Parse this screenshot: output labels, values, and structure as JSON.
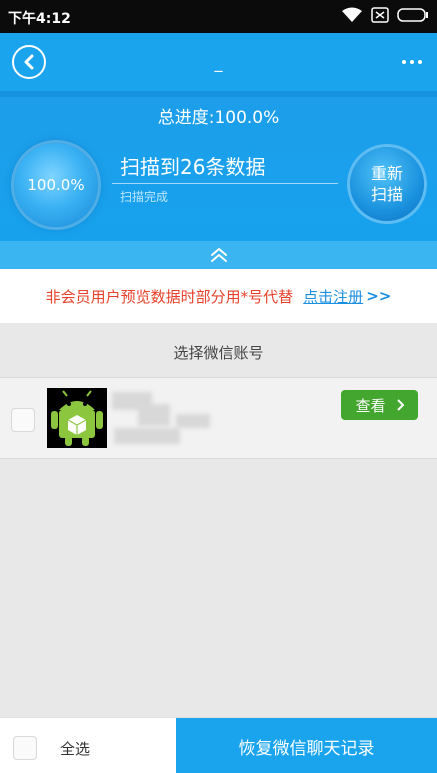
{
  "status_bar": {
    "time": "下午4:12"
  },
  "header": {
    "title": "_",
    "back_icon": "back-arrow-icon",
    "menu_icon": "more-dots-icon"
  },
  "progress": {
    "total_label": "总进度:100.0%",
    "circle_percent": "100.0%",
    "scan_title": "扫描到26条数据",
    "scan_status": "扫描完成",
    "rescan_line1": "重新",
    "rescan_line2": "扫描"
  },
  "notice": {
    "text": "非会员用户预览数据时部分用*号代替",
    "link": "点击注册",
    "arrows": ">>"
  },
  "accounts": {
    "section_title": "选择微信账号",
    "view_label": "查看",
    "items": [
      {
        "avatar_icon": "android-icon"
      }
    ]
  },
  "bottom": {
    "select_all": "全选",
    "recover_button": "恢复微信聊天记录"
  },
  "colors": {
    "primary": "#1aa4ee",
    "accent_green": "#43a72f",
    "notice_red": "#e8412b",
    "link_blue": "#1a8fe0"
  }
}
